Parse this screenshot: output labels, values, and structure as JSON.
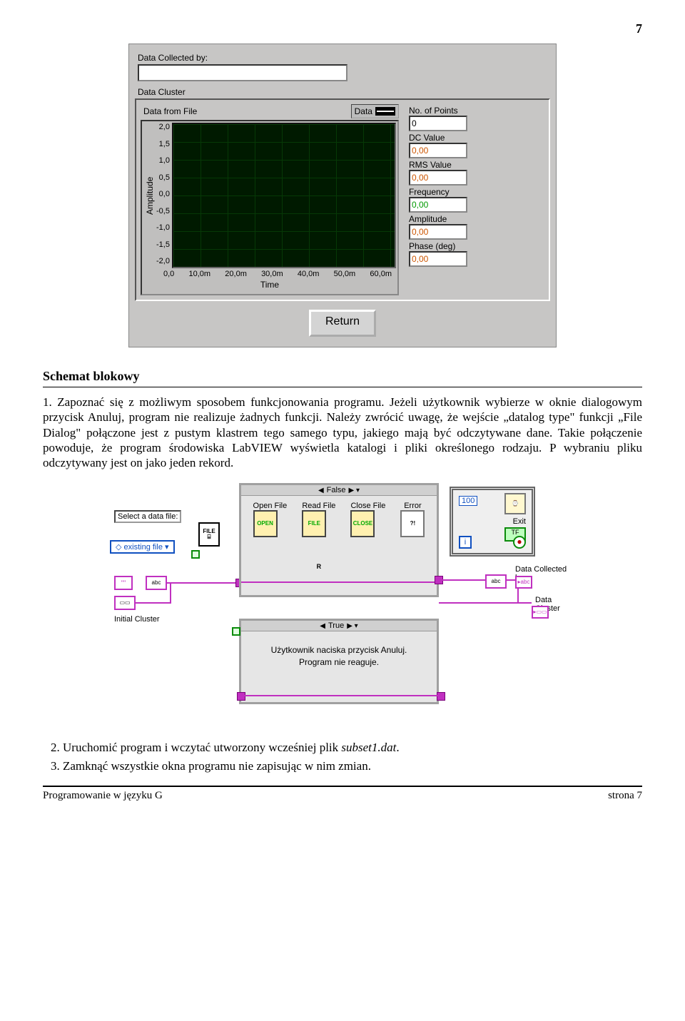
{
  "page": {
    "tr_number": "7",
    "footer_left": "Programowanie w języku G",
    "footer_right": "strona 7"
  },
  "panel": {
    "data_collected_label": "Data Collected by:",
    "data_collected_value": "",
    "cluster_label": "Data Cluster",
    "graph_title": "Data from File",
    "legend": "Data",
    "ylabel": "Amplitude",
    "xlabel": "Time",
    "yticks": [
      "2,0",
      "1,5",
      "1,0",
      "0,5",
      "0,0",
      "-0,5",
      "-1,0",
      "-1,5",
      "-2,0"
    ],
    "xticks": [
      "0,0",
      "10,0m",
      "20,0m",
      "30,0m",
      "40,0m",
      "50,0m",
      "60,0m"
    ],
    "side": [
      {
        "label": "No. of Points",
        "value": "0",
        "cls": ""
      },
      {
        "label": "DC Value",
        "value": "0,00",
        "cls": "sc-box-orange"
      },
      {
        "label": "RMS Value",
        "value": "0,00",
        "cls": "sc-box-orange"
      },
      {
        "label": "Frequency",
        "value": "0,00",
        "cls": "sc-box-green"
      },
      {
        "label": "Amplitude",
        "value": "0,00",
        "cls": "sc-box-orange"
      },
      {
        "label": "Phase (deg)",
        "value": "0,00",
        "cls": "sc-box-orange"
      }
    ],
    "return_btn": "Return"
  },
  "heading": "Schemat blokowy",
  "paragraph1": "1.  Zapoznać się z możliwym sposobem funkcjonowania programu. Jeżeli użytkownik wybierze w oknie dialogowym przycisk Anuluj, program nie realizuje żadnych funkcji. Należy zwrócić uwagę, że wejście „datalog type\" funkcji „File Dialog\" połączone jest z pustym klastrem tego samego typu, jakiego mają być odczytywane dane. Takie połączenie powoduje, że program środowiska LabVIEW wyświetla katalogi i pliki określonego rodzaju. P wybraniu pliku odczytywany jest on jako jeden rekord.",
  "diagram": {
    "select_label": "Select a data file:",
    "existing_file": "existing file",
    "initial_cluster": "Initial Cluster",
    "case_false": "False",
    "case_true": "True",
    "open_file": "Open File",
    "read_file": "Read File",
    "close_file": "Close File",
    "open_caption": "OPEN",
    "file_caption": "FILE",
    "close_caption": "CLOSE",
    "error_label": "Error",
    "exit_label": "Exit",
    "hundred": "100",
    "i_label": "i",
    "data_collected_by": "Data Collected by:",
    "data_cluster": "Data Cluster",
    "true_text": "Użytkownik naciska przycisk Anuluj. Program nie reaguje."
  },
  "list": [
    "Uruchomić program i wczytać utworzony wcześniej plik subset1.dat.",
    "Zamknąć wszystkie okna programu nie zapisując w nim zmian."
  ],
  "chart_data": {
    "type": "line",
    "title": "Data from File",
    "xlabel": "Time",
    "ylabel": "Amplitude",
    "xlim": [
      0,
      0.06
    ],
    "ylim": [
      -2.0,
      2.0
    ],
    "series": [
      {
        "name": "Data",
        "x": [],
        "y": []
      }
    ],
    "note": "empty plot"
  }
}
